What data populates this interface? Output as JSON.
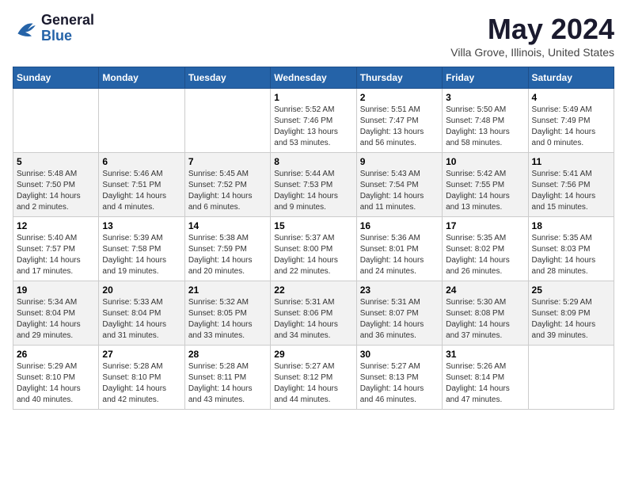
{
  "header": {
    "logo_general": "General",
    "logo_blue": "Blue",
    "month_title": "May 2024",
    "subtitle": "Villa Grove, Illinois, United States"
  },
  "days_of_week": [
    "Sunday",
    "Monday",
    "Tuesday",
    "Wednesday",
    "Thursday",
    "Friday",
    "Saturday"
  ],
  "weeks": [
    [
      {
        "day": "",
        "info": ""
      },
      {
        "day": "",
        "info": ""
      },
      {
        "day": "",
        "info": ""
      },
      {
        "day": "1",
        "info": "Sunrise: 5:52 AM\nSunset: 7:46 PM\nDaylight: 13 hours and 53 minutes."
      },
      {
        "day": "2",
        "info": "Sunrise: 5:51 AM\nSunset: 7:47 PM\nDaylight: 13 hours and 56 minutes."
      },
      {
        "day": "3",
        "info": "Sunrise: 5:50 AM\nSunset: 7:48 PM\nDaylight: 13 hours and 58 minutes."
      },
      {
        "day": "4",
        "info": "Sunrise: 5:49 AM\nSunset: 7:49 PM\nDaylight: 14 hours and 0 minutes."
      }
    ],
    [
      {
        "day": "5",
        "info": "Sunrise: 5:48 AM\nSunset: 7:50 PM\nDaylight: 14 hours and 2 minutes."
      },
      {
        "day": "6",
        "info": "Sunrise: 5:46 AM\nSunset: 7:51 PM\nDaylight: 14 hours and 4 minutes."
      },
      {
        "day": "7",
        "info": "Sunrise: 5:45 AM\nSunset: 7:52 PM\nDaylight: 14 hours and 6 minutes."
      },
      {
        "day": "8",
        "info": "Sunrise: 5:44 AM\nSunset: 7:53 PM\nDaylight: 14 hours and 9 minutes."
      },
      {
        "day": "9",
        "info": "Sunrise: 5:43 AM\nSunset: 7:54 PM\nDaylight: 14 hours and 11 minutes."
      },
      {
        "day": "10",
        "info": "Sunrise: 5:42 AM\nSunset: 7:55 PM\nDaylight: 14 hours and 13 minutes."
      },
      {
        "day": "11",
        "info": "Sunrise: 5:41 AM\nSunset: 7:56 PM\nDaylight: 14 hours and 15 minutes."
      }
    ],
    [
      {
        "day": "12",
        "info": "Sunrise: 5:40 AM\nSunset: 7:57 PM\nDaylight: 14 hours and 17 minutes."
      },
      {
        "day": "13",
        "info": "Sunrise: 5:39 AM\nSunset: 7:58 PM\nDaylight: 14 hours and 19 minutes."
      },
      {
        "day": "14",
        "info": "Sunrise: 5:38 AM\nSunset: 7:59 PM\nDaylight: 14 hours and 20 minutes."
      },
      {
        "day": "15",
        "info": "Sunrise: 5:37 AM\nSunset: 8:00 PM\nDaylight: 14 hours and 22 minutes."
      },
      {
        "day": "16",
        "info": "Sunrise: 5:36 AM\nSunset: 8:01 PM\nDaylight: 14 hours and 24 minutes."
      },
      {
        "day": "17",
        "info": "Sunrise: 5:35 AM\nSunset: 8:02 PM\nDaylight: 14 hours and 26 minutes."
      },
      {
        "day": "18",
        "info": "Sunrise: 5:35 AM\nSunset: 8:03 PM\nDaylight: 14 hours and 28 minutes."
      }
    ],
    [
      {
        "day": "19",
        "info": "Sunrise: 5:34 AM\nSunset: 8:04 PM\nDaylight: 14 hours and 29 minutes."
      },
      {
        "day": "20",
        "info": "Sunrise: 5:33 AM\nSunset: 8:04 PM\nDaylight: 14 hours and 31 minutes."
      },
      {
        "day": "21",
        "info": "Sunrise: 5:32 AM\nSunset: 8:05 PM\nDaylight: 14 hours and 33 minutes."
      },
      {
        "day": "22",
        "info": "Sunrise: 5:31 AM\nSunset: 8:06 PM\nDaylight: 14 hours and 34 minutes."
      },
      {
        "day": "23",
        "info": "Sunrise: 5:31 AM\nSunset: 8:07 PM\nDaylight: 14 hours and 36 minutes."
      },
      {
        "day": "24",
        "info": "Sunrise: 5:30 AM\nSunset: 8:08 PM\nDaylight: 14 hours and 37 minutes."
      },
      {
        "day": "25",
        "info": "Sunrise: 5:29 AM\nSunset: 8:09 PM\nDaylight: 14 hours and 39 minutes."
      }
    ],
    [
      {
        "day": "26",
        "info": "Sunrise: 5:29 AM\nSunset: 8:10 PM\nDaylight: 14 hours and 40 minutes."
      },
      {
        "day": "27",
        "info": "Sunrise: 5:28 AM\nSunset: 8:10 PM\nDaylight: 14 hours and 42 minutes."
      },
      {
        "day": "28",
        "info": "Sunrise: 5:28 AM\nSunset: 8:11 PM\nDaylight: 14 hours and 43 minutes."
      },
      {
        "day": "29",
        "info": "Sunrise: 5:27 AM\nSunset: 8:12 PM\nDaylight: 14 hours and 44 minutes."
      },
      {
        "day": "30",
        "info": "Sunrise: 5:27 AM\nSunset: 8:13 PM\nDaylight: 14 hours and 46 minutes."
      },
      {
        "day": "31",
        "info": "Sunrise: 5:26 AM\nSunset: 8:14 PM\nDaylight: 14 hours and 47 minutes."
      },
      {
        "day": "",
        "info": ""
      }
    ]
  ]
}
